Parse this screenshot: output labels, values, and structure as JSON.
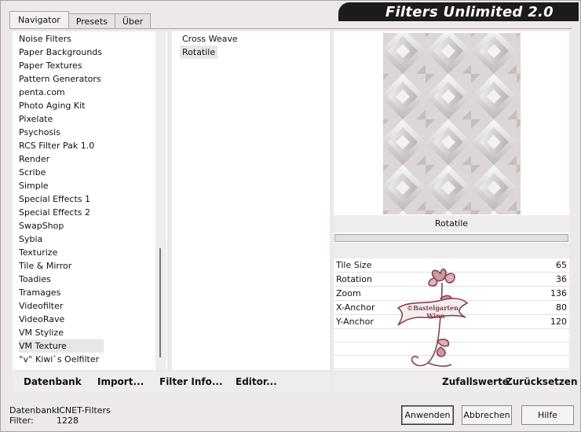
{
  "tabs": [
    {
      "label": "Navigator",
      "active": true
    },
    {
      "label": "Presets",
      "active": false
    },
    {
      "label": "Über",
      "active": false
    }
  ],
  "banner": {
    "title": "Filters Unlimited 2.0"
  },
  "categories": [
    "Noise Filters",
    "Paper Backgrounds",
    "Paper Textures",
    "Pattern Generators",
    "penta.com",
    "Photo Aging Kit",
    "Pixelate",
    "Psychosis",
    "RCS Filter Pak 1.0",
    "Render",
    "Scribe",
    "Simple",
    "Special Effects 1",
    "Special Effects 2",
    "SwapShop",
    "Sybia",
    "Texturize",
    "Tile & Mirror",
    "Toadies",
    "Tramages",
    "Videofilter",
    "VideoRave",
    "VM Stylize",
    "VM Texture",
    "°v° Kiwi`s Oelfilter"
  ],
  "selected_category": "VM Texture",
  "filters": [
    "Cross Weave",
    "Rotatile"
  ],
  "selected_filter": "Rotatile",
  "preview": {
    "title": "Rotatile"
  },
  "params": [
    {
      "name": "Tile Size",
      "value": "65"
    },
    {
      "name": "Rotation",
      "value": "36"
    },
    {
      "name": "Zoom",
      "value": "136"
    },
    {
      "name": "X-Anchor",
      "value": "80"
    },
    {
      "name": "Y-Anchor",
      "value": "120"
    }
  ],
  "watermark": {
    "line1": "©Bastelgarten",
    "line2": "Winn"
  },
  "links_left": {
    "datenbank": "Datenbank",
    "import": "Import...",
    "filter_info": "Filter Info...",
    "editor": "Editor..."
  },
  "links_right": {
    "random": "Zufallswerte",
    "reset": "Zurücksetzen"
  },
  "status": {
    "db_label": "Datenbank:",
    "db_value": "ICNET-Filters",
    "filter_label": "Filter:",
    "filter_value": "1228"
  },
  "buttons": {
    "apply": "Anwenden",
    "cancel": "Abbrechen",
    "help": "Hilfe"
  },
  "colors": {
    "banner_bg": "#1c1a1b",
    "window_bg": "#ece9e8",
    "watermark": "#8a4250"
  }
}
